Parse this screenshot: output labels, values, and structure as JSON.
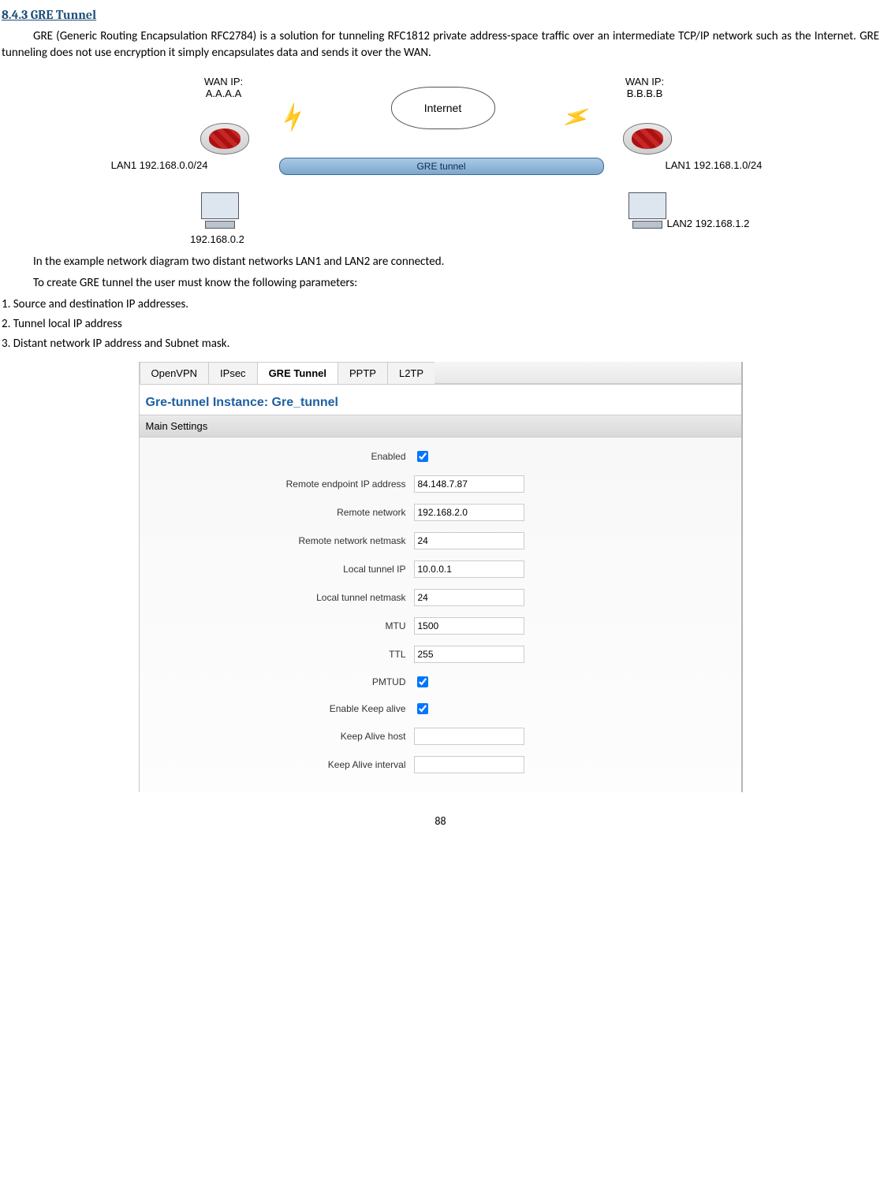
{
  "heading": {
    "number": "8.4.3",
    "title": "GRE Tunnel"
  },
  "para1": "GRE (Generic Routing Encapsulation RFC2784) is a solution for tunneling RFC1812 private address-space traffic over an intermediate TCP/IP network such as the Internet. GRE tunneling does not use encryption it simply encapsulates data and sends it over the WAN.",
  "diagram": {
    "wan_left": "WAN IP:\nA.A.A.A",
    "wan_right": "WAN IP:\nB.B.B.B",
    "internet": "Internet",
    "tunnel": "GRE tunnel",
    "lan_left": "LAN1 192.168.0.0/24",
    "lan_right_top": "LAN1 192.168.1.0/24",
    "pc_left": "192.168.0.2",
    "pc_right": "LAN2 192.168.1.2"
  },
  "para2": "In the example network diagram two distant networks LAN1 and LAN2 are connected.",
  "para3": "To create GRE tunnel the user must know the following parameters:",
  "list": {
    "i1": "1. Source and destination IP addresses.",
    "i2": "2. Tunnel local IP address",
    "i3": "3. Distant network IP address and Subnet mask."
  },
  "panel": {
    "tabs": {
      "t1": "OpenVPN",
      "t2": "IPsec",
      "t3": "GRE Tunnel",
      "t4": "PPTP",
      "t5": "L2TP"
    },
    "instance_title": "Gre-tunnel Instance: Gre_tunnel",
    "section": "Main Settings",
    "fields": {
      "enabled": "Enabled",
      "remote_ip_lbl": "Remote endpoint IP address",
      "remote_ip_val": "84.148.7.87",
      "remote_net_lbl": "Remote network",
      "remote_net_val": "192.168.2.0",
      "remote_mask_lbl": "Remote network netmask",
      "remote_mask_val": "24",
      "local_ip_lbl": "Local tunnel IP",
      "local_ip_val": "10.0.0.1",
      "local_mask_lbl": "Local tunnel netmask",
      "local_mask_val": "24",
      "mtu_lbl": "MTU",
      "mtu_val": "1500",
      "ttl_lbl": "TTL",
      "ttl_val": "255",
      "pmtud_lbl": "PMTUD",
      "keepalive_lbl": "Enable Keep alive",
      "ka_host_lbl": "Keep Alive host",
      "ka_host_val": "",
      "ka_int_lbl": "Keep Alive interval",
      "ka_int_val": ""
    }
  },
  "page_number": "88"
}
